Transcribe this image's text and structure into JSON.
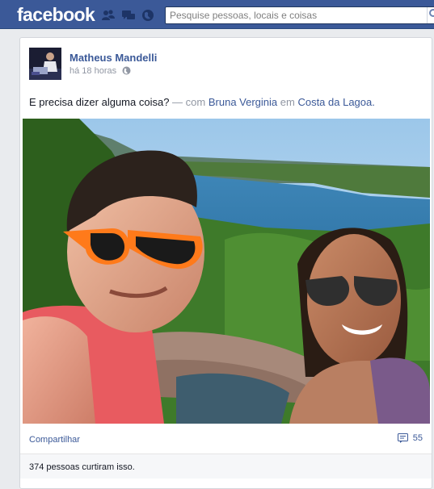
{
  "topbar": {
    "logo": "facebook",
    "icons": [
      "friend-requests-icon",
      "messages-icon",
      "notifications-icon",
      "search-icon"
    ],
    "search_placeholder": "Pesquise pessoas, locais e coisas"
  },
  "post": {
    "author": "Matheus Mandelli",
    "time": "há 18 horas",
    "privacy_icon": "globe-icon",
    "text": "E precisa dizer alguma coisa?",
    "with_sep": "—",
    "with_label": "com",
    "tagged_person": "Bruna Verginia",
    "location_prep": "em",
    "location": "Costa da Lagoa.",
    "share_label": "Compartilhar",
    "comment_icon": "comment-icon",
    "comment_count": "55",
    "likes_text": "374 pessoas curtiram isso."
  },
  "colors": {
    "brand": "#3b5998",
    "link": "#3b5998",
    "muted": "#9197a3",
    "background": "#e9ebee"
  }
}
